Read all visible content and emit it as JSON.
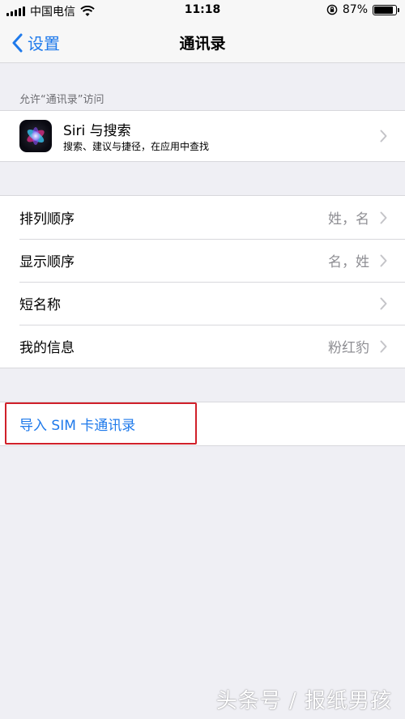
{
  "status_bar": {
    "carrier": "中国电信",
    "time": "11:18",
    "battery_percent": "87%",
    "battery_level": 0.87,
    "icons": [
      "signal-icon",
      "wifi-icon",
      "rotation-lock-icon",
      "battery-icon"
    ]
  },
  "nav": {
    "back_label": "设置",
    "title": "通讯录"
  },
  "access_section": {
    "header": "允许“通讯录”访问",
    "siri_title": "Siri 与搜索",
    "siri_subtitle": "搜索、建议与捷径，在应用中查找"
  },
  "settings": {
    "sort_order_label": "排列顺序",
    "sort_order_value": "姓，名",
    "display_order_label": "显示顺序",
    "display_order_value": "名，姓",
    "short_name_label": "短名称",
    "my_info_label": "我的信息",
    "my_info_value": "粉红豹"
  },
  "import": {
    "label": "导入 SIM 卡通讯录"
  },
  "watermark": "头条号 / 报纸男孩",
  "colors": {
    "accent": "#1f7aeb",
    "background": "#efeff4",
    "highlight": "#d0202a",
    "secondary_text": "#8e8e93"
  }
}
